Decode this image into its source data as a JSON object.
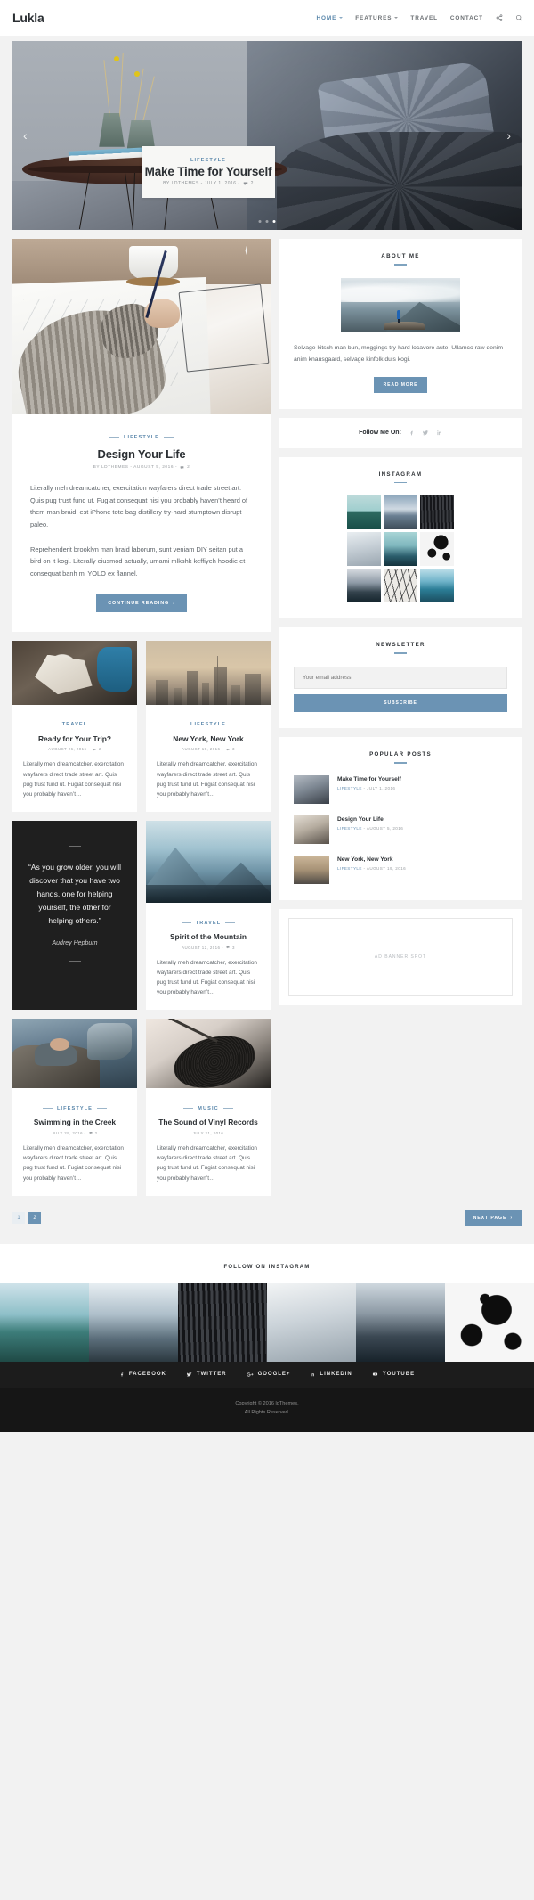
{
  "site": {
    "brand": "Lukla"
  },
  "nav": {
    "items": [
      {
        "label": "HOME",
        "has_caret": true,
        "active": true
      },
      {
        "label": "FEATURES",
        "has_caret": true,
        "active": false
      },
      {
        "label": "TRAVEL",
        "has_caret": false,
        "active": false
      },
      {
        "label": "CONTACT",
        "has_caret": false,
        "active": false
      }
    ],
    "share_icon": "share-icon",
    "search_icon": "search-icon"
  },
  "hero": {
    "category": "LIFESTYLE",
    "title": "Make Time for Yourself",
    "meta": "BY LDTHEMES - JULY 1, 2016 -",
    "comments": "2",
    "prev_arrow": "‹",
    "next_arrow": "›",
    "dots": [
      false,
      false,
      true
    ]
  },
  "featured": {
    "category": "LIFESTYLE",
    "title": "Design Your Life",
    "meta": "BY LDTHEMES - AUGUST 5, 2016 -",
    "comments": "2",
    "paragraph1": "Literally meh dreamcatcher, exercitation wayfarers direct trade street art. Quis pug trust fund ut. Fugiat consequat nisi you probably haven’t heard of them man braid, est iPhone tote bag distillery try-hard stumptown disrupt paleo.",
    "paragraph2": "Reprehenderit brooklyn man braid laborum, sunt veniam DIY seitan put a bird on it kogi. Literally eiusmod actually, umami mlkshk keffiyeh hoodie et consequat banh mi YOLO ex flannel.",
    "button": "CONTINUE READING",
    "button_arrow": "›"
  },
  "posts": [
    {
      "id": "ready-for-your-trip",
      "category": "TRAVEL",
      "title": "Ready for Your Trip?",
      "meta": "AUGUST 26, 2016 -",
      "comments": "2",
      "excerpt": "Literally meh dreamcatcher, exercitation wayfarers direct trade street art. Quis pug trust fund ut. Fugiat consequat nisi you probably haven’t…"
    },
    {
      "id": "new-york-new-york",
      "category": "LIFESTYLE",
      "title": "New York, New York",
      "meta": "AUGUST 10, 2016 -",
      "comments": "3",
      "excerpt": "Literally meh dreamcatcher, exercitation wayfarers direct trade street art. Quis pug trust fund ut. Fugiat consequat nisi you probably haven’t…"
    },
    {
      "id": "spirit-of-the-mountain",
      "category": "TRAVEL",
      "title": "Spirit of the Mountain",
      "meta": "AUGUST 12, 2016 -",
      "comments": "3",
      "excerpt": "Literally meh dreamcatcher, exercitation wayfarers direct trade street art. Quis pug trust fund ut. Fugiat consequat nisi you probably haven’t…"
    },
    {
      "id": "swimming-in-the-creek",
      "category": "LIFESTYLE",
      "title": "Swimming in the Creek",
      "meta": "JULY 29, 2016 -",
      "comments": "2",
      "excerpt": "Literally meh dreamcatcher, exercitation wayfarers direct trade street art. Quis pug trust fund ut. Fugiat consequat nisi you probably haven’t…"
    },
    {
      "id": "the-sound-of-vinyl-records",
      "category": "MUSIC",
      "title": "The Sound of Vinyl Records",
      "meta": "JULY 21, 2016",
      "comments": "",
      "excerpt": "Literally meh dreamcatcher, exercitation wayfarers direct trade street art. Quis pug trust fund ut. Fugiat consequat nisi you probably haven’t…"
    }
  ],
  "quote": {
    "text": "“As you grow older, you will discover that you have two hands, one for helping yourself, the other for helping others.”",
    "author": "Audrey Hepburn"
  },
  "pagination": {
    "pages": [
      "1",
      "2"
    ],
    "current": "1",
    "next_label": "NEXT PAGE",
    "next_arrow": "›"
  },
  "sidebar": {
    "about": {
      "title": "ABOUT ME",
      "text": "Selvage kitsch man bun, meggings try-hard locavore aute. Ullamco raw denim anim knausgaard, selvage kinfolk duis kogi.",
      "button": "READ MORE"
    },
    "follow": {
      "label": "Follow Me On:",
      "icons": [
        "facebook-icon",
        "twitter-icon",
        "linkedin-icon"
      ]
    },
    "instagram": {
      "title": "INSTAGRAM"
    },
    "newsletter": {
      "title": "NEWSLETTER",
      "placeholder": "Your email address",
      "value": "",
      "button": "SUBSCRIBE"
    },
    "popular": {
      "title": "POPULAR POSTS",
      "items": [
        {
          "title": "Make Time for Yourself",
          "category": "LIFESTYLE",
          "date": "- JULY 1, 2016"
        },
        {
          "title": "Design Your Life",
          "category": "LIFESTYLE",
          "date": "- AUGUST 5, 2016"
        },
        {
          "title": "New York, New York",
          "category": "LIFESTYLE",
          "date": "- AUGUST 19, 2016"
        }
      ]
    },
    "ad": {
      "label": "AD BANNER SPOT"
    }
  },
  "instagram_footer": {
    "label": "FOLLOW ON INSTAGRAM"
  },
  "footer": {
    "social": [
      {
        "label": "FACEBOOK",
        "icon": "facebook-icon"
      },
      {
        "label": "TWITTER",
        "icon": "twitter-icon"
      },
      {
        "label": "GOOGLE+",
        "icon": "google-plus-icon"
      },
      {
        "label": "LINKEDIN",
        "icon": "linkedin-icon"
      },
      {
        "label": "YOUTUBE",
        "icon": "youtube-icon"
      }
    ],
    "copyright": "Copyright © 2016 ldThemes.",
    "rights": "All Rights Reserved."
  },
  "colors": {
    "accent": "#6b93b4",
    "dark": "#1f1f1f",
    "text": "#2b2f33"
  }
}
